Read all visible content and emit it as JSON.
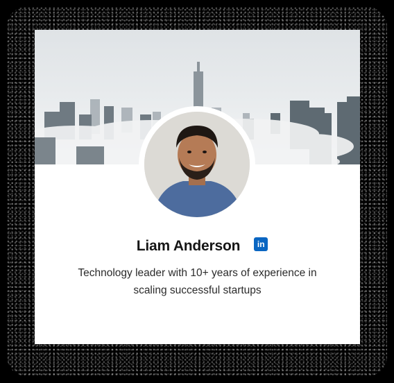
{
  "profile": {
    "name": "Liam Anderson",
    "bio": "Technology leader with 10+ years of experience in scaling successful startups",
    "social_icon": "linkedin-icon",
    "social_icon_glyph": "in"
  },
  "colors": {
    "linkedin": "#0a66c2",
    "card_background": "#ffffff",
    "page_background": "#000000"
  }
}
